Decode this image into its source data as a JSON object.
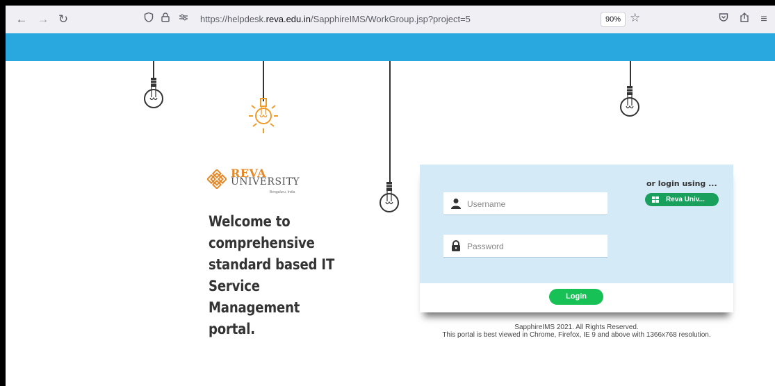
{
  "browser": {
    "url_prefix": "https://helpdesk.",
    "url_domain": "reva.edu.in",
    "url_path": "/SapphireIMS/WorkGroup.jsp?project=5",
    "zoom": "90%"
  },
  "logo": {
    "line1": "REVA",
    "line2": "UNIVERSITY",
    "line3": "Bengaluru, India"
  },
  "welcome": {
    "lines": [
      "Welcome to",
      "comprehensive",
      "standard based IT",
      "Service Management",
      "portal."
    ]
  },
  "login": {
    "username_placeholder": "Username",
    "password_placeholder": "Password",
    "or_login_using": "or login using ...",
    "sso_button": "Reva Univ...",
    "login_button": "Login"
  },
  "footer": {
    "line1": "SapphireIMS 2021. All Rights Reserved.",
    "line2": "This portal is best viewed in Chrome, Firefox, IE 9 and above with 1366x768 resolution."
  },
  "colors": {
    "banner": "#29a8df",
    "panel": "#d4eaf6",
    "accent_green": "#18c155",
    "logo_orange": "#e4892a"
  }
}
